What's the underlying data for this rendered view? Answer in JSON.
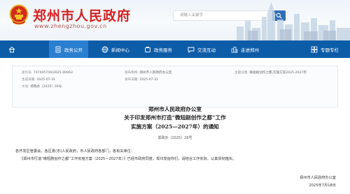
{
  "header": {
    "site_name": "郑州市人民政府",
    "domain": "www.zhengzhou.gov.cn",
    "search_placeholder": "请输入关键字"
  },
  "nav": {
    "items": [
      {
        "label": "政务公开",
        "icon": "document-icon",
        "active": true
      },
      {
        "label": "新闻中心",
        "icon": "news-icon",
        "active": false
      },
      {
        "label": "政务服务",
        "icon": "service-icon",
        "active": false
      },
      {
        "label": "交流互动",
        "icon": "chat-icon",
        "active": false
      },
      {
        "label": "走进郑州",
        "icon": "city-icon",
        "active": false
      },
      {
        "label": "专题专栏",
        "icon": "topic-icon",
        "active": false
      }
    ]
  },
  "meta": {
    "index_label": "索引号:",
    "index_value": "74744574X/2025-00063",
    "issuer_label": "发布机构:",
    "issuer_value": "郑州市人民政府办公室",
    "subject_label": "主题分类:",
    "subject_value": "微短剧创作之都,实施方案2025-2027年",
    "date_label": "生成日期:",
    "date_value": "2025-07-31",
    "publish_label": "发布日期:",
    "publish_value": "2025-07-31",
    "docno_label": "文号:",
    "docno_value": "郑政办〔2025〕26号"
  },
  "document": {
    "title_1": "郑州市人民政府办公室",
    "title_2": "关于印发郑州市打造“微短剧创作之都”工作",
    "title_3": "实施方案（2025—2027年）的通知",
    "doc_number": "郑政办〔2025〕26号",
    "salutation": "各开发区管委会，各区县(市)人民政府，市人民政府各部门，各有关单位：",
    "body": "《郑州市打造“微短剧创作之都”工作实施方案（2025—2027年）》已经市政府同意，现印发给你们，请结合工作实际，认真贯彻落实。",
    "signature": "郑州市人民政府办公室",
    "sign_date": "2025年7月18日"
  },
  "colors": {
    "nav_bg": "#0d5ca8",
    "nav_active": "#2b7fd0",
    "site_name_red": "#d42222"
  }
}
